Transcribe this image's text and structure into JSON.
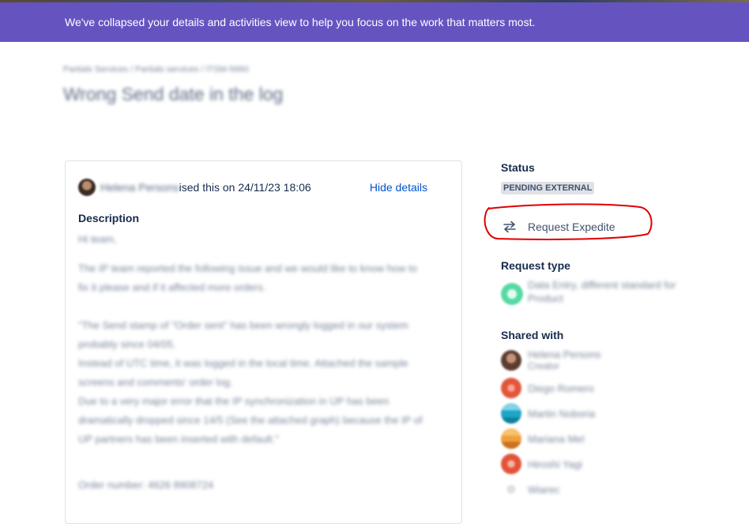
{
  "banner": {
    "message": "We've collapsed your details and activities view to help you focus on the work that matters most."
  },
  "breadcrumb": {
    "text": "Partials Services / Partials services / ITSM-5660"
  },
  "issue": {
    "title": "Wrong Send date in the log"
  },
  "activity": {
    "reporter_name": "Helena Persons",
    "raised_suffix": "ised this on 24/11/23 18:06",
    "hide_details": "Hide details"
  },
  "description": {
    "heading": "Description",
    "lines": [
      "Hi team,",
      "The IP team reported the following issue and we would like to know how to",
      "fix it please and if it affected more orders.",
      "",
      "\"The Send stamp of \"Order sent\" has been wrongly logged in our system",
      "probably since 04/05.",
      "Instead of UTC time, it was logged in the local time. Attached the sample",
      "screens and comments' order log.",
      "Due to a very major error that the IP synchronization in UP has been",
      "dramatically dropped since 14/5 (See the attached graph) because the IP of",
      "UP partners has been inserted with default.\"",
      "",
      "Order number: 4626 8908724"
    ]
  },
  "sidebar": {
    "status_heading": "Status",
    "status_value": "PENDING EXTERNAL",
    "expedite_label": "Request Expedite",
    "request_type_heading": "Request type",
    "request_type_value_line1": "Data Entry, different standard for",
    "request_type_value_line2": "Product",
    "shared_with_heading": "Shared with",
    "shared_with": [
      {
        "name": "Helena Persons",
        "sub": "Creator",
        "color": "#5a3d30"
      },
      {
        "name": "Diego Romero",
        "sub": "",
        "color": "#e2563b"
      },
      {
        "name": "Martin Noboria",
        "sub": "",
        "color": "#1da4c6"
      },
      {
        "name": "Mariana Mel",
        "sub": "",
        "color": "#f0a03a"
      },
      {
        "name": "Hiroshi Yagi",
        "sub": "",
        "color": "#e3533a"
      },
      {
        "name": "Wiarec",
        "sub": "",
        "color": "#c1c7d0"
      }
    ]
  },
  "colors": {
    "banner_bg": "#6554c0",
    "link": "#0052cc",
    "annotation": "#e00000"
  }
}
